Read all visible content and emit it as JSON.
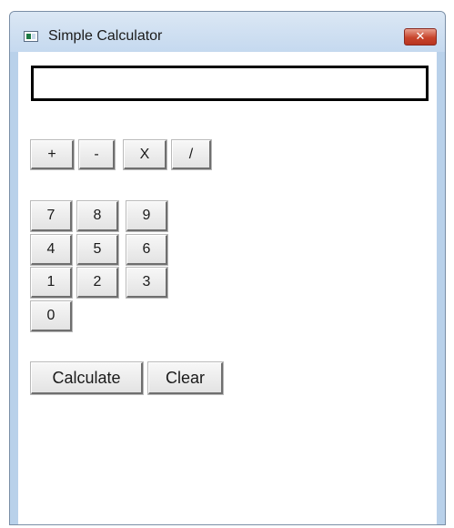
{
  "window": {
    "title": "Simple Calculator",
    "close_label": "✕"
  },
  "display": {
    "value": ""
  },
  "operators": [
    "+",
    "-",
    "X",
    "/"
  ],
  "digits": [
    "7",
    "8",
    "9",
    "4",
    "5",
    "6",
    "1",
    "2",
    "3",
    "0"
  ],
  "actions": {
    "calculate_label": "Calculate",
    "clear_label": "Clear"
  },
  "colors": {
    "titlebar": "#c5d9ef",
    "frame": "#b9d1ea",
    "close_button": "#c8452c",
    "display_border": "#000000"
  },
  "icons": {
    "app": "app-window-icon",
    "close": "close-icon"
  }
}
